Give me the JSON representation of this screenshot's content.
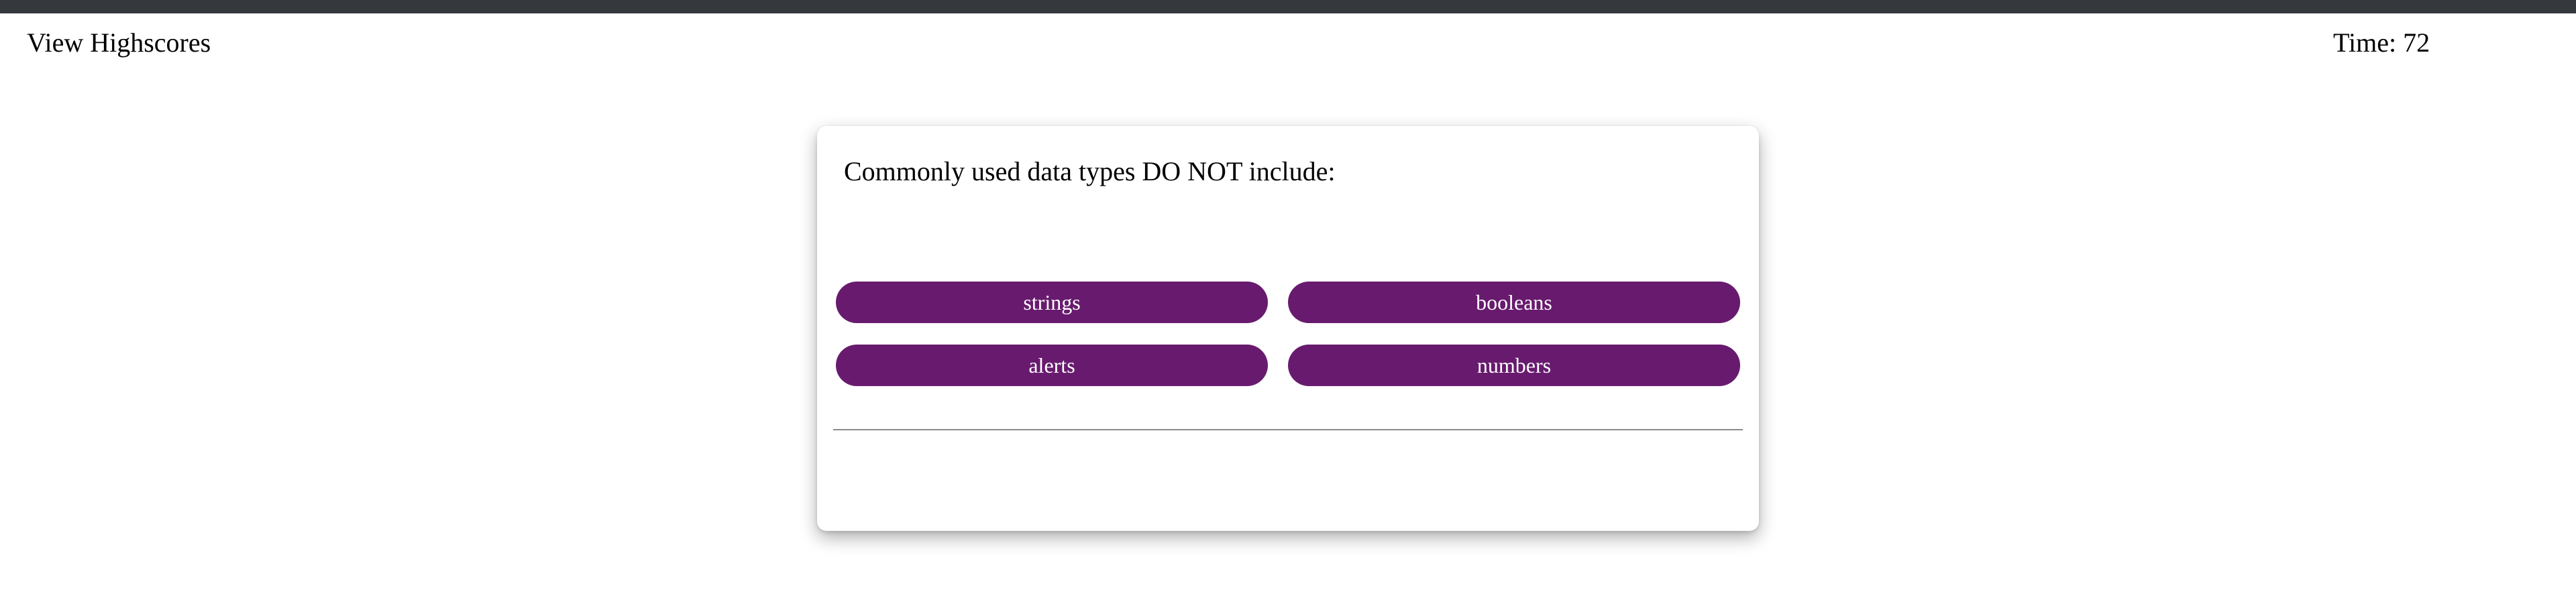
{
  "header": {
    "highscores_label": "View Highscores",
    "timer_label": "Time:",
    "timer_value": "72"
  },
  "quiz": {
    "question": "Commonly used data types DO NOT include:",
    "choices": [
      {
        "label": "strings"
      },
      {
        "label": "booleans"
      },
      {
        "label": "alerts"
      },
      {
        "label": "numbers"
      }
    ],
    "feedback": ""
  },
  "colors": {
    "topbar": "#35383d",
    "button_bg": "#681b6e",
    "button_text": "#ffffff"
  }
}
